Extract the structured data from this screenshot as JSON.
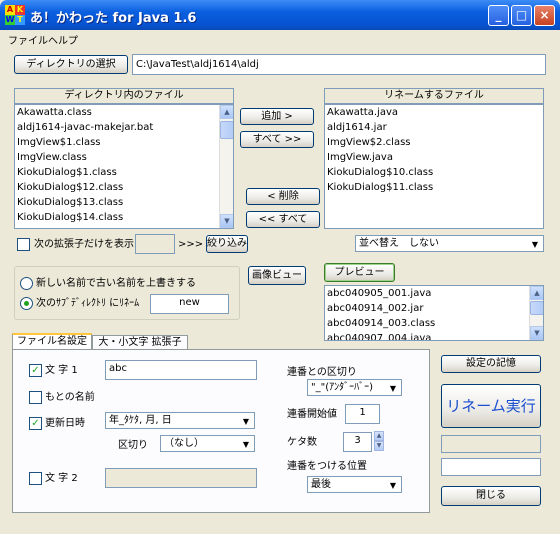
{
  "window": {
    "title": "あ！かわった for Java 1.6",
    "icon_letters": [
      "A",
      "K",
      "W",
      "T"
    ],
    "minimize": "_",
    "maximize": "□",
    "close": "×"
  },
  "menu": [
    "ファイル",
    "ヘルプ"
  ],
  "directory": {
    "select_button": "ディレクトリの選択",
    "path": "C:\\JavaTest\\aldj1614\\aldj"
  },
  "source_list": {
    "header": "ディレクトリ内のファイル",
    "items": [
      "Akawatta.class",
      "aldj1614-javac-makejar.bat",
      "ImgView$1.class",
      "ImgView.class",
      "KiokuDialog$1.class",
      "KiokuDialog$12.class",
      "KiokuDialog$13.class",
      "KiokuDialog$14.class"
    ]
  },
  "target_list": {
    "header": "リネームするファイル",
    "items": [
      "Akawatta.java",
      "aldj1614.jar",
      "ImgView$2.class",
      "ImgView.java",
      "KiokuDialog$10.class",
      "KiokuDialog$11.class"
    ]
  },
  "transfer": {
    "add": "追加 >",
    "add_all": "すべて >>",
    "remove": "< 削除",
    "remove_all": "<< すべて"
  },
  "filter": {
    "label": "次の拡張子だけを表示",
    "value": "",
    "arrows": ">>>",
    "button": "絞り込み"
  },
  "sort": {
    "selected": "並べ替え　しない"
  },
  "mode": {
    "overwrite_label": "新しい名前で古い名前を上書きする",
    "subdir_label": "次のｻﾌﾞﾃﾞｨﾚｸﾄﾘ にﾘﾈｰﾑ",
    "subdir_value": "new"
  },
  "image_view_button": "画像ビュー",
  "preview": {
    "button": "プレビュー",
    "items": [
      "abc040905_001.java",
      "abc040914_002.jar",
      "abc040914_003.class",
      "abc040907_004.java"
    ]
  },
  "tabs": [
    "ファイル名設定",
    "大・小文字 拡張子"
  ],
  "settings": {
    "text1_label": "文 字 1",
    "text1_value": "abc",
    "original_name_label": "もとの名前",
    "datetime_label": "更新日時",
    "datetime_format": "年_ﾀｹﾀ, 月, 日",
    "separator_label": "区切り",
    "separator_value": "（なし）",
    "text2_label": "文 字 2",
    "text2_value": "",
    "seq_separator_label": "連番との区切り",
    "seq_separator_value": "\"_\"(ｱﾝﾀﾞｰﾊﾞｰ)",
    "seq_start_label": "連番開始値",
    "seq_start_value": "1",
    "digits_label": "ケタ数",
    "digits_value": "3",
    "seq_position_label": "連番をつける位置",
    "seq_position_value": "最後"
  },
  "side_buttons": {
    "save_settings": "設定の記憶",
    "rename": "リネーム実行",
    "close": "閉じる"
  },
  "colors": {
    "title_bar": "#0654d4",
    "rename_text": "#1a4fd0",
    "check_mark": "#21a121"
  }
}
